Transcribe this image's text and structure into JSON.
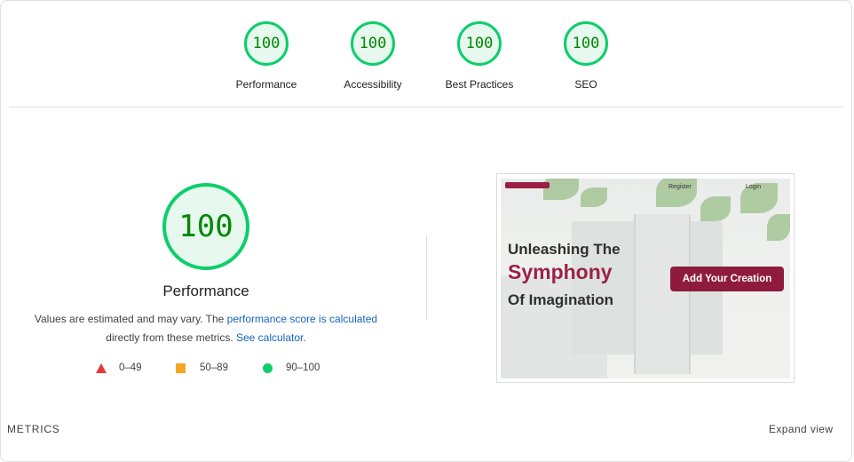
{
  "categories": [
    {
      "label": "Performance",
      "score": "100"
    },
    {
      "label": "Accessibility",
      "score": "100"
    },
    {
      "label": "Best Practices",
      "score": "100"
    },
    {
      "label": "SEO",
      "score": "100"
    }
  ],
  "main": {
    "score": "100",
    "title": "Performance",
    "desc_part1": "Values are estimated and may vary. The ",
    "desc_link1": "performance score is calculated",
    "desc_part2": "directly from these metrics. ",
    "desc_link2": "See calculator",
    "desc_part3": "."
  },
  "legend": {
    "fail": "0–49",
    "average": "50–89",
    "pass": "90–100"
  },
  "screenshot": {
    "nav_register": "Register",
    "nav_login": "Login",
    "heading_line1": "Unleashing The",
    "heading_line2": "Symphony",
    "heading_line3": "Of Imagination",
    "cta": "Add Your Creation"
  },
  "footer": {
    "metrics_label": "METRICS",
    "expand_label": "Expand view"
  },
  "colors": {
    "pass": "#0cce6b",
    "pass_text": "#008800",
    "average": "#f5a623",
    "fail": "#e53935",
    "link": "#1565c0",
    "brand": "#8e1b3e"
  }
}
